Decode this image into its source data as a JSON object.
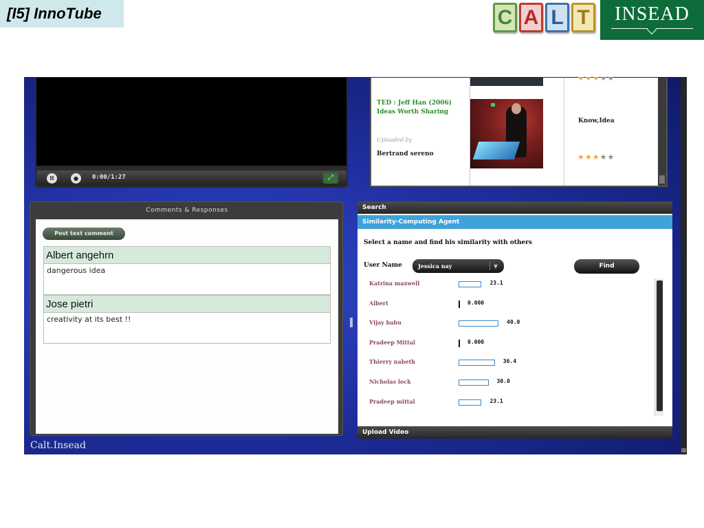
{
  "slide": {
    "title": "[I5] InnoTube",
    "logos": {
      "calt_letters": [
        "C",
        "A",
        "L",
        "T"
      ],
      "insead_text": "INSEAD"
    }
  },
  "video_player": {
    "time": "0:00/1:27"
  },
  "video_list": {
    "title_line1": "TED : Jeff Han (2006)",
    "title_line2": "Ideas Worth Sharing",
    "uploaded_by_label": "Uploaded by",
    "uploader": "Bertrand sereno",
    "tags": "Know,Idea",
    "rating": 3,
    "rating_max": 5
  },
  "comments": {
    "header": "Comments & Responses",
    "post_button": "Post text comment",
    "items": [
      {
        "author": "Albert angehrn",
        "text": "dangerous idea"
      },
      {
        "author": "Jose pietri",
        "text": "creativity at its best !!"
      }
    ]
  },
  "similarity": {
    "search_label": "Search",
    "agent_label": "Similarity-Computing Agent",
    "instruction": "Select a name and find his similarity with others",
    "user_name_label": "User Name",
    "selected_user": "Jessica nay",
    "find_button": "Find",
    "upload_label": "Upload Video",
    "results": [
      {
        "name": "Katrina maxwell",
        "value": "23.1",
        "score": 23.1
      },
      {
        "name": "Albert",
        "value": "0.000",
        "score": 0
      },
      {
        "name": "Vijay babu",
        "value": "40.0",
        "score": 40.0
      },
      {
        "name": "Pradeep Mittal",
        "value": "0.000",
        "score": 0
      },
      {
        "name": "Thierry nabeth",
        "value": "36.4",
        "score": 36.4
      },
      {
        "name": "Nicholas lock",
        "value": "30.0",
        "score": 30.0
      },
      {
        "name": "Pradeep mittal",
        "value": "23.1",
        "score": 23.1
      }
    ]
  },
  "footer": {
    "brand": "Calt.Insead"
  },
  "colors": {
    "title_bg": "#cfe8ec",
    "insead_green": "#0e6b3a",
    "agent_blue": "#3fa2d9",
    "comment_header_bg": "#d6e9dd",
    "result_name": "#8a4a5a"
  }
}
